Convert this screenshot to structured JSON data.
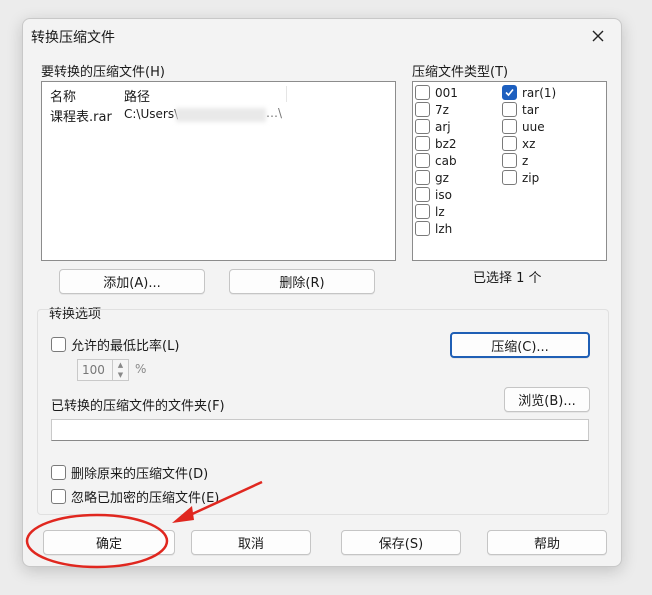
{
  "window": {
    "title": "转换压缩文件"
  },
  "files_panel": {
    "label": "要转换的压缩文件(H)",
    "columns": [
      "名称",
      "路径"
    ],
    "rows": [
      {
        "name": "课程表.rar",
        "path": "C:\\Users\\"
      }
    ],
    "path_tail": "…\\"
  },
  "types_panel": {
    "label": "压缩文件类型(T)",
    "left_column": [
      {
        "label": "001",
        "checked": false
      },
      {
        "label": "7z",
        "checked": false
      },
      {
        "label": "arj",
        "checked": false
      },
      {
        "label": "bz2",
        "checked": false
      },
      {
        "label": "cab",
        "checked": false
      },
      {
        "label": "gz",
        "checked": false
      },
      {
        "label": "iso",
        "checked": false
      },
      {
        "label": "lz",
        "checked": false
      },
      {
        "label": "lzh",
        "checked": false
      }
    ],
    "right_column": [
      {
        "label": "rar(1)",
        "checked": true
      },
      {
        "label": "tar",
        "checked": false
      },
      {
        "label": "uue",
        "checked": false
      },
      {
        "label": "xz",
        "checked": false
      },
      {
        "label": "z",
        "checked": false
      },
      {
        "label": "zip",
        "checked": false
      }
    ],
    "selected_text": "已选择 1 个"
  },
  "file_buttons": {
    "add": "添加(A)...",
    "delete": "删除(R)"
  },
  "options": {
    "label": "转换选项",
    "min_ratio": "允许的最低比率(L)",
    "ratio_value": "100",
    "ratio_unit": "%",
    "compress_button": "压缩(C)...",
    "folder_label": "已转换的压缩文件的文件夹(F)",
    "folder_value": "",
    "browse_button": "浏览(B)...",
    "delete_original": "删除原来的压缩文件(D)",
    "ignore_encrypted": "忽略已加密的压缩文件(E)"
  },
  "footer": {
    "ok": "确定",
    "cancel": "取消",
    "save": "保存(S)",
    "help": "帮助"
  },
  "colors": {
    "accent": "#1d5fbf",
    "annotation": "#e0271f"
  }
}
